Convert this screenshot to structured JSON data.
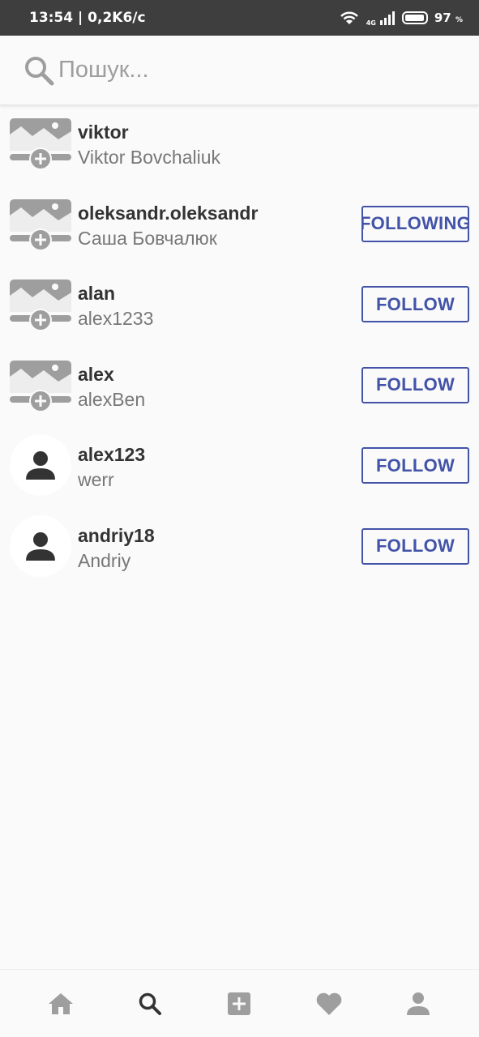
{
  "status_bar": {
    "time_speed": "13:54 | 0,2K6/c",
    "network": "4G",
    "battery_level": 97,
    "battery_value": "97",
    "battery_unit": "%"
  },
  "search": {
    "placeholder": "Пошук..."
  },
  "users": [
    {
      "username": "viktor",
      "fullname": "Viktor Bovchaliuk",
      "avatar": "image-add-icon",
      "button": ""
    },
    {
      "username": "oleksandr.oleksandr",
      "fullname": "Саша Бовчалюк",
      "avatar": "image-add-icon",
      "button": "FOLLOWING"
    },
    {
      "username": "alan",
      "fullname": "alex1233",
      "avatar": "image-add-icon",
      "button": "FOLLOW"
    },
    {
      "username": "alex",
      "fullname": "alexBen",
      "avatar": "image-add-icon",
      "button": "FOLLOW"
    },
    {
      "username": "alex123",
      "fullname": "werr",
      "avatar": "person-icon",
      "button": "FOLLOW"
    },
    {
      "username": "andriy18",
      "fullname": "Andriy",
      "avatar": "person-icon",
      "button": "FOLLOW"
    }
  ],
  "bottom_nav": [
    "home-icon",
    "search-icon",
    "add-box-icon",
    "heart-icon",
    "profile-icon"
  ],
  "colors": {
    "accent": "#4353a8",
    "icon_gray": "#9e9e9e",
    "text_dark": "#333333"
  }
}
